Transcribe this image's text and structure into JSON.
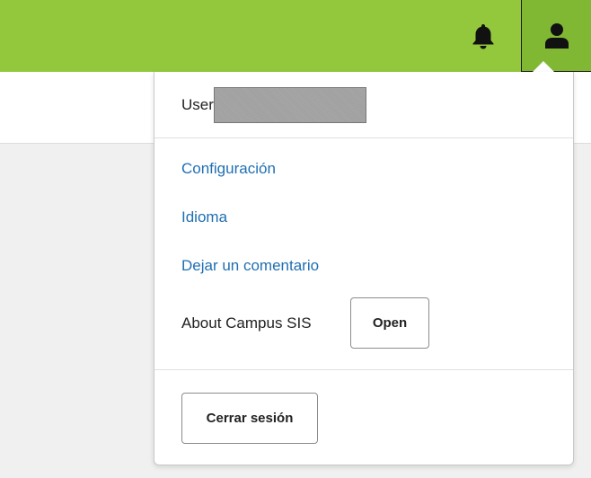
{
  "header": {
    "bg_color": "#93c83d",
    "active_bg_color": "#80b833",
    "icons": [
      "bell-icon",
      "user-icon"
    ]
  },
  "menu": {
    "user_label": "User",
    "links": [
      {
        "label": "Configuración",
        "color": "#1f6fb2"
      },
      {
        "label": "Idioma",
        "color": "#1f6fb2"
      },
      {
        "label": "Dejar un comentario",
        "color": "#1f6fb2"
      }
    ],
    "about_label": "About Campus SIS",
    "open_button": "Open",
    "logout_button": "Cerrar sesión"
  }
}
